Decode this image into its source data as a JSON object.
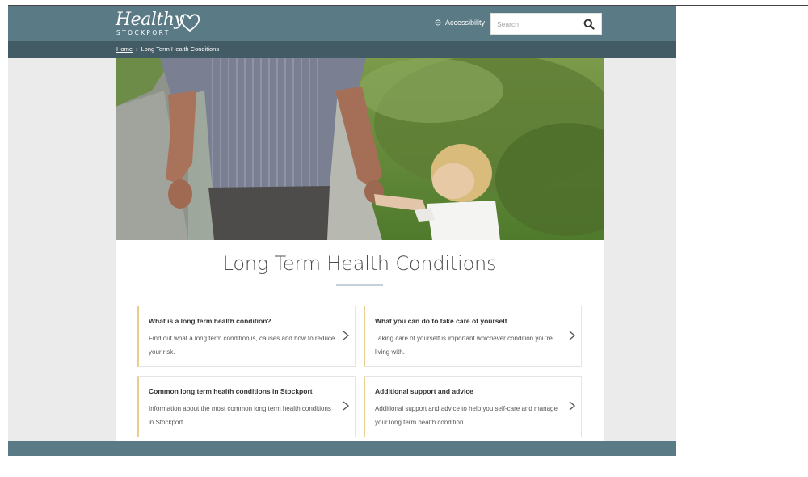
{
  "header": {
    "logo_text": "Healthy",
    "logo_subtext": "STOCKPORT",
    "accessibility_label": "Accessibility",
    "search": {
      "placeholder": "Search"
    }
  },
  "breadcrumb": {
    "items": [
      {
        "label": "Home",
        "link": true
      },
      {
        "label": "Long Term Health Conditions",
        "link": false
      }
    ],
    "separator": "›"
  },
  "page": {
    "title": "Long Term Health Conditions",
    "cards": [
      {
        "title": "What is a long term health condition?",
        "description": "Find out what a long term condition is, causes and how to reduce your risk."
      },
      {
        "title": "What you can do to take care of yourself",
        "description": "Taking care of yourself is important whichever condition you're living with."
      },
      {
        "title": "Common long term health conditions in Stockport",
        "description": "Information about the most common long term health conditions in Stockport."
      },
      {
        "title": "Additional support and advice",
        "description": "Additional support and advice to help you self-care and manage your long term health condition."
      }
    ]
  },
  "colors": {
    "header": "#5a7a86",
    "breadcrumb_bar": "#435b64",
    "card_accent": "#e8cf8f",
    "page_bg": "#ebebeb"
  }
}
